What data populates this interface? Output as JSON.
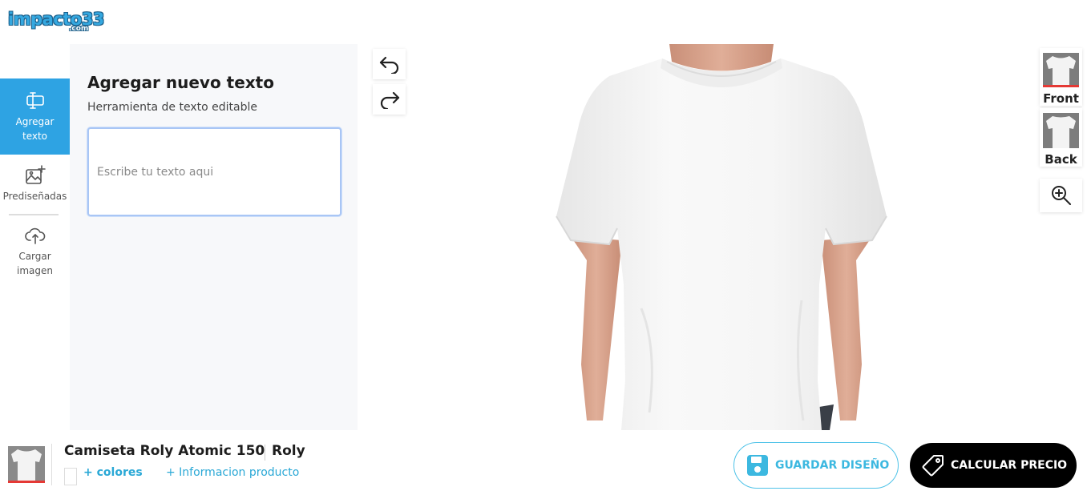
{
  "brand": {
    "logo_main": "impacto33",
    "logo_sub": ".com"
  },
  "sidebar": {
    "items": [
      {
        "label_line1": "Agregar",
        "label_line2": "texto",
        "icon": "text-tool-icon",
        "active": true
      },
      {
        "label_line1": "Prediseñadas",
        "label_line2": "",
        "icon": "image-add-icon",
        "active": false
      },
      {
        "label_line1": "Cargar",
        "label_line2": "imagen",
        "icon": "cloud-upload-icon",
        "active": false
      }
    ]
  },
  "panel": {
    "title": "Agregar nuevo texto",
    "subtitle": "Herramienta de texto editable",
    "input_placeholder": "Escribe tu texto aqui",
    "input_value": ""
  },
  "views": {
    "front_label": "Front",
    "back_label": "Back",
    "zoom_icon": "zoom-in-icon"
  },
  "product": {
    "name": "Camiseta Roly Atomic 150",
    "brand": "Roly",
    "more_colors": "+ colores",
    "more_info": "+ Informacion producto"
  },
  "actions": {
    "save_label": "GUARDAR DISEÑO",
    "price_label": "CALCULAR PRECIO"
  },
  "colors": {
    "accent": "#2ea3e3",
    "link": "#2aa8d6",
    "price_button": "#000000",
    "thumb_underline": "#e53935"
  }
}
